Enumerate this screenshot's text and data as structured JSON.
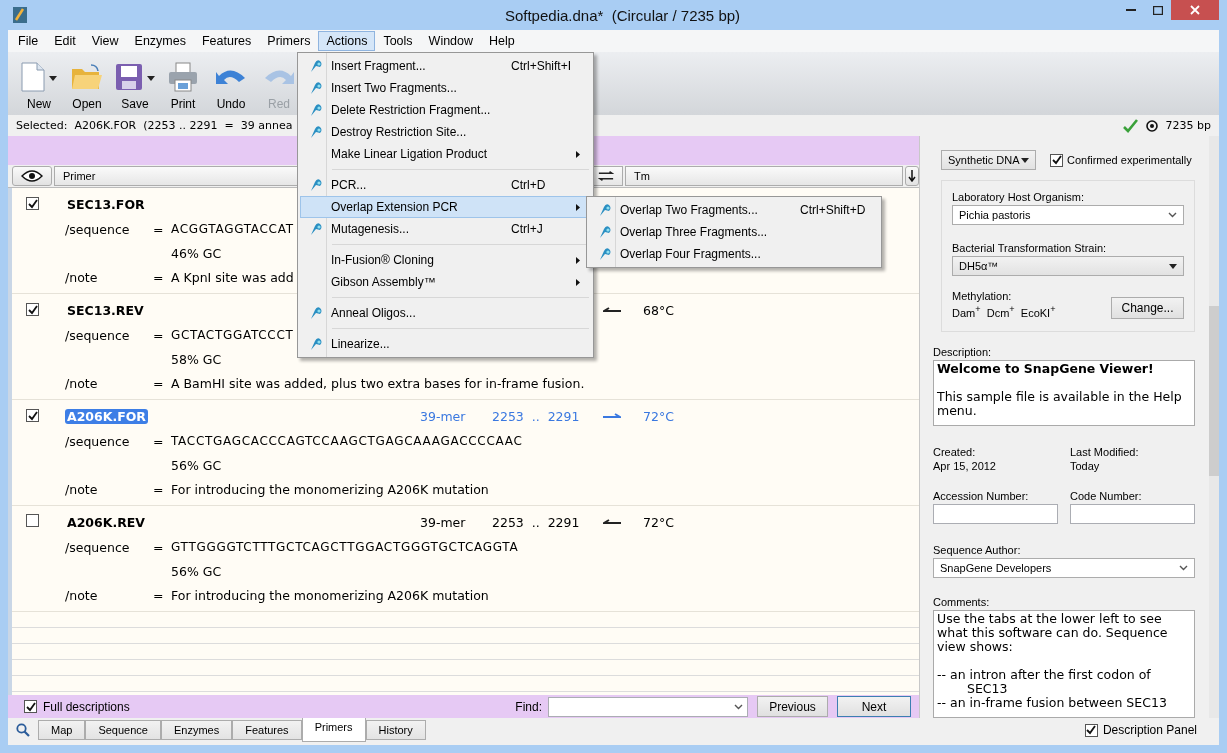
{
  "window": {
    "title": "Softpedia.dna*  (Circular / 7235 bp)"
  },
  "menubar": [
    {
      "label": "File",
      "selected": false
    },
    {
      "label": "Edit",
      "selected": false
    },
    {
      "label": "View",
      "selected": false
    },
    {
      "label": "Enzymes",
      "selected": false
    },
    {
      "label": "Features",
      "selected": false
    },
    {
      "label": "Primers",
      "selected": false
    },
    {
      "label": "Actions",
      "selected": true
    },
    {
      "label": "Tools",
      "selected": false
    },
    {
      "label": "Window",
      "selected": false
    },
    {
      "label": "Help",
      "selected": false
    }
  ],
  "toolbar": [
    {
      "label": "New",
      "dropdown": true,
      "disabled": false
    },
    {
      "label": "Open",
      "dropdown": false,
      "disabled": false
    },
    {
      "label": "Save",
      "dropdown": true,
      "disabled": false
    },
    {
      "label": "Print",
      "dropdown": false,
      "disabled": false
    },
    {
      "label": "Undo",
      "dropdown": false,
      "disabled": false
    },
    {
      "label": "Red",
      "dropdown": false,
      "disabled": true
    }
  ],
  "status": {
    "selection": "Selected:  A206K.FOR  (2253 .. 2291  =  39 annea",
    "length": "7235 bp"
  },
  "columns": {
    "primer": "Primer",
    "tm": "Tm"
  },
  "primers": [
    {
      "name": "SEC13.FOR",
      "checked": true,
      "selected": false,
      "fields": [
        {
          "kind": "sequence",
          "label": "/sequence",
          "eq": "=",
          "value": "ACGGTAGGTACCAT"
        },
        {
          "kind": "gc",
          "value": "46% GC"
        },
        {
          "kind": "note",
          "label": "/note",
          "eq": "=",
          "value": "A KpnI site was add"
        }
      ]
    },
    {
      "name": "SEC13.REV",
      "checked": true,
      "selected": false,
      "forward": false,
      "tm": "68°C",
      "fields": [
        {
          "kind": "sequence",
          "label": "/sequence",
          "eq": "=",
          "value": "GCTACTGGATCCCT"
        },
        {
          "kind": "gc",
          "value": "58% GC"
        },
        {
          "kind": "note",
          "label": "/note",
          "eq": "=",
          "value": "A BamHI site was added, plus two extra bases for in-frame fusion."
        }
      ]
    },
    {
      "name": "A206K.FOR",
      "checked": true,
      "selected": true,
      "length": "39-mer",
      "range": "2253  ..  2291",
      "forward": true,
      "tm": "72°C",
      "fields": [
        {
          "kind": "sequence",
          "label": "/sequence",
          "eq": "=",
          "value": "TACCTGAGCACCCAGTCCAAGCTGAGCAAAGACCCCAAC"
        },
        {
          "kind": "gc",
          "value": "56% GC"
        },
        {
          "kind": "note",
          "label": "/note",
          "eq": "=",
          "value": "For introducing the monomerizing A206K mutation"
        }
      ]
    },
    {
      "name": "A206K.REV",
      "checked": false,
      "selected": false,
      "length": "39-mer",
      "range": "2253  ..  2291",
      "forward": false,
      "tm": "72°C",
      "fields": [
        {
          "kind": "sequence",
          "label": "/sequence",
          "eq": "=",
          "value": "GTTGGGGTCTTTGCTCAGCTTGGACTGGGTGCTCAGGTA"
        },
        {
          "kind": "gc",
          "value": "56% GC"
        },
        {
          "kind": "note",
          "label": "/note",
          "eq": "=",
          "value": "For introducing the monomerizing A206K mutation"
        }
      ]
    }
  ],
  "bottom_bar": {
    "full_descriptions": {
      "label": "Full descriptions",
      "checked": true
    },
    "find_label": "Find:",
    "previous": "Previous",
    "next": "Next"
  },
  "tabs": [
    {
      "label": "Map",
      "selected": false
    },
    {
      "label": "Sequence",
      "selected": false
    },
    {
      "label": "Enzymes",
      "selected": false
    },
    {
      "label": "Features",
      "selected": false
    },
    {
      "label": "Primers",
      "selected": true
    },
    {
      "label": "History",
      "selected": false
    }
  ],
  "description_panel_toggle": {
    "label": "Description Panel",
    "checked": true
  },
  "actions_menu": [
    {
      "kind": "item",
      "label": "Insert Fragment...",
      "shortcut": "Ctrl+Shift+I",
      "icon": true,
      "submenu": false,
      "selected": false
    },
    {
      "kind": "item",
      "label": "Insert Two Fragments...",
      "icon": true,
      "submenu": false,
      "selected": false
    },
    {
      "kind": "item",
      "label": "Delete Restriction Fragment...",
      "icon": true,
      "submenu": false,
      "selected": false
    },
    {
      "kind": "item",
      "label": "Destroy Restriction Site...",
      "icon": true,
      "submenu": false,
      "selected": false
    },
    {
      "kind": "item",
      "label": "Make Linear Ligation Product",
      "icon": false,
      "submenu": true,
      "selected": false
    },
    {
      "kind": "separator"
    },
    {
      "kind": "item",
      "label": "PCR...",
      "shortcut": "Ctrl+D",
      "icon": true,
      "submenu": false,
      "selected": false
    },
    {
      "kind": "item",
      "label": "Overlap Extension PCR",
      "icon": false,
      "submenu": true,
      "selected": true
    },
    {
      "kind": "item",
      "label": "Mutagenesis...",
      "shortcut": "Ctrl+J",
      "icon": true,
      "submenu": false,
      "selected": false
    },
    {
      "kind": "separator"
    },
    {
      "kind": "item",
      "label": "In-Fusion® Cloning",
      "icon": false,
      "submenu": true,
      "selected": false
    },
    {
      "kind": "item",
      "label": "Gibson Assembly™",
      "icon": false,
      "submenu": true,
      "selected": false
    },
    {
      "kind": "separator"
    },
    {
      "kind": "item",
      "label": "Anneal Oligos...",
      "icon": true,
      "submenu": false,
      "selected": false
    },
    {
      "kind": "separator"
    },
    {
      "kind": "item",
      "label": "Linearize...",
      "icon": true,
      "submenu": false,
      "selected": false
    }
  ],
  "overlap_submenu": [
    {
      "kind": "item",
      "label": "Overlap Two Fragments...",
      "shortcut": "Ctrl+Shift+D",
      "icon": true,
      "submenu": false,
      "selected": false
    },
    {
      "kind": "item",
      "label": "Overlap Three Fragments...",
      "icon": true,
      "submenu": false,
      "selected": false
    },
    {
      "kind": "item",
      "label": "Overlap Four Fragments...",
      "icon": true,
      "submenu": false,
      "selected": false
    }
  ],
  "side_panel": {
    "molecule_type": "Synthetic DNA",
    "confirmed": {
      "label": "Confirmed experimentally",
      "checked": true
    },
    "host": {
      "label": "Laboratory Host Organism:",
      "value": "Pichia pastoris"
    },
    "strain": {
      "label": "Bacterial Transformation Strain:",
      "value": "DH5α™"
    },
    "methylation": {
      "label": "Methylation:",
      "value": "Dam$^{+}$  Dcm$^{+}$  EcoKI$^{+}$",
      "button": "Change..."
    },
    "description": {
      "label": "Description:",
      "title": "Welcome to SnapGene Viewer!",
      "text": "This sample file is available in the Help menu."
    },
    "created": {
      "label": "Created:",
      "value": "Apr 15, 2012"
    },
    "modified": {
      "label": "Last Modified:",
      "value": "Today"
    },
    "accession": {
      "label": "Accession Number:"
    },
    "code": {
      "label": "Code Number:"
    },
    "author": {
      "label": "Sequence Author:",
      "value": "SnapGene Developers"
    },
    "comments": {
      "label": "Comments:",
      "paragraphs": [
        {
          "kind": "text",
          "text": "Use the tabs at the lower left to see what this software can do. Sequence view shows:"
        },
        {
          "kind": "bullet",
          "text": "-- an intron after the first codon of SEC13"
        },
        {
          "kind": "bullet",
          "text": "-- an in-frame fusion between SEC13"
        }
      ]
    }
  }
}
